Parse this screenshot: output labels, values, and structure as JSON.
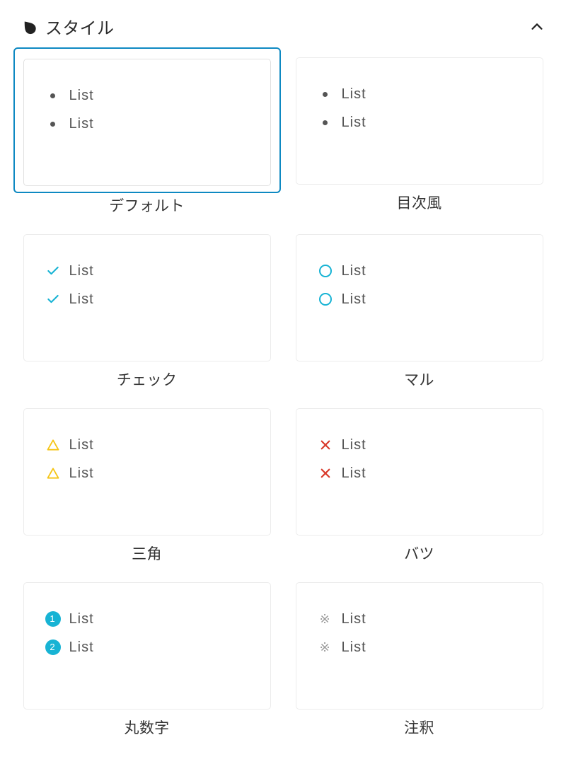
{
  "panel": {
    "title": "スタイル",
    "list_item_text": "List"
  },
  "options": [
    {
      "id": "default",
      "label": "デフォルト",
      "selected": true,
      "marker": "dot"
    },
    {
      "id": "toc",
      "label": "目次風",
      "selected": false,
      "marker": "dot"
    },
    {
      "id": "check",
      "label": "チェック",
      "selected": false,
      "marker": "check"
    },
    {
      "id": "circle",
      "label": "マル",
      "selected": false,
      "marker": "ring"
    },
    {
      "id": "triangle",
      "label": "三角",
      "selected": false,
      "marker": "triangle"
    },
    {
      "id": "cross",
      "label": "バツ",
      "selected": false,
      "marker": "cross"
    },
    {
      "id": "numbered",
      "label": "丸数字",
      "selected": false,
      "marker": "num"
    },
    {
      "id": "note",
      "label": "注釈",
      "selected": false,
      "marker": "kome"
    }
  ]
}
